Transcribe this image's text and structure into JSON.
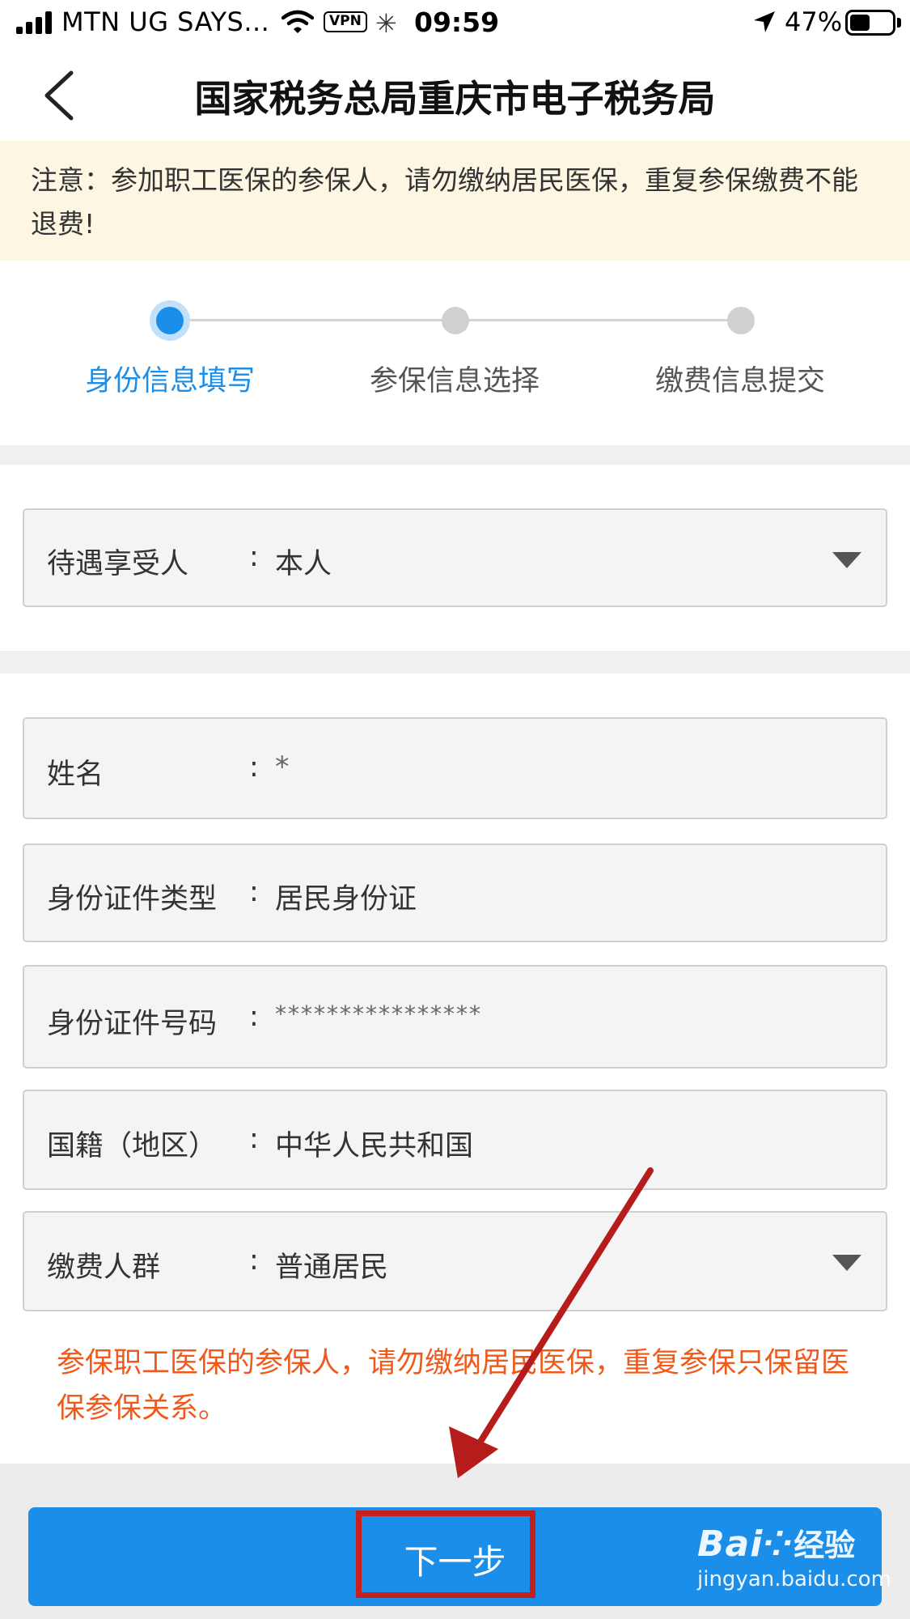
{
  "status_bar": {
    "carrier": "MTN UG SAYS...",
    "vpn": "VPN",
    "time": "09:59",
    "battery": "47%",
    "battery_level": 0.47
  },
  "nav": {
    "back_icon": "chevron-left-icon",
    "title": "国家税务总局重庆市电子税务局"
  },
  "notice": {
    "text": "注意：参加职工医保的参保人，请勿缴纳居民医保，重复参保缴费不能退费!"
  },
  "steps": [
    {
      "label": "身份信息填写",
      "active": true
    },
    {
      "label": "参保信息选择",
      "active": false
    },
    {
      "label": "缴费信息提交",
      "active": false
    }
  ],
  "fields": {
    "beneficiary": {
      "label": "待遇享受人",
      "colon": ":",
      "value": "本人"
    },
    "name": {
      "label": "姓名",
      "colon": ":",
      "value": "*"
    },
    "id_type": {
      "label": "身份证件类型",
      "colon": ":",
      "value": "居民身份证"
    },
    "id_number": {
      "label": "身份证件号码",
      "colon": ":",
      "value": "****************"
    },
    "nationality": {
      "label": "国籍（地区）",
      "colon": ":",
      "value": "中华人民共和国"
    },
    "payer_group": {
      "label": "缴费人群",
      "colon": ":",
      "value": "普通居民"
    }
  },
  "warning": {
    "text": "参保职工医保的参保人，请勿缴纳居民医保，重复参保只保留医保参保关系。"
  },
  "next_button": {
    "label": "下一步"
  },
  "watermark": {
    "logo": "Bai",
    "logo_cn": "经验",
    "url": "jingyan.baidu.com"
  },
  "colors": {
    "accent": "#1a8ee8",
    "warning": "#f0591a",
    "annotation": "#c81e1e",
    "notice_bg": "#fdf6e2"
  }
}
